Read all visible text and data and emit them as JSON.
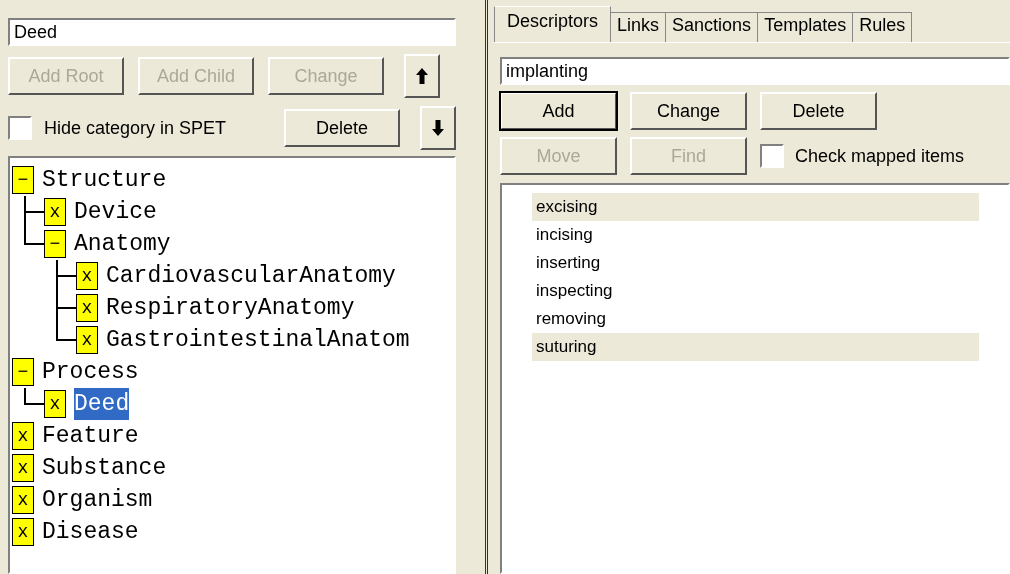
{
  "category_editor": {
    "name_field": {
      "value": "Deed"
    },
    "buttons": [
      {
        "label": "Add Root",
        "disabled": true
      },
      {
        "label": "Add Child",
        "disabled": true
      },
      {
        "label": "Change",
        "disabled": true
      }
    ],
    "move_up_button": {
      "disabled": false
    },
    "hide_checkbox": {
      "label": "Hide category in SPET",
      "checked": false
    },
    "delete_button": {
      "label": "Delete",
      "disabled": false
    },
    "move_down_button": {
      "disabled": false
    },
    "tree": [
      {
        "label": "Structure",
        "toggle": "−",
        "selected": false,
        "children": [
          {
            "label": "Device",
            "toggle": "x",
            "selected": false
          },
          {
            "label": "Anatomy",
            "toggle": "−",
            "selected": false,
            "children": [
              {
                "label": "CardiovascularAnatomy",
                "toggle": "x",
                "selected": false
              },
              {
                "label": "RespiratoryAnatomy",
                "toggle": "x",
                "selected": false
              },
              {
                "label": "GastrointestinalAnatom",
                "toggle": "x",
                "selected": false
              }
            ]
          }
        ]
      },
      {
        "label": "Process",
        "toggle": "−",
        "selected": false,
        "children": [
          {
            "label": "Deed",
            "toggle": "x",
            "selected": true
          }
        ]
      },
      {
        "label": "Feature",
        "toggle": "x",
        "selected": false
      },
      {
        "label": "Substance",
        "toggle": "x",
        "selected": false
      },
      {
        "label": "Organism",
        "toggle": "x",
        "selected": false
      },
      {
        "label": "Disease",
        "toggle": "x",
        "selected": false
      }
    ]
  },
  "tabs": [
    {
      "label": "Descriptors",
      "selected": true
    },
    {
      "label": "Links",
      "selected": false
    },
    {
      "label": "Sanctions",
      "selected": false
    },
    {
      "label": "Templates",
      "selected": false
    },
    {
      "label": "Rules",
      "selected": false
    }
  ],
  "descriptors": {
    "descriptor_field": {
      "value": "implanting"
    },
    "buttons_row_1": [
      {
        "label": "Add",
        "disabled": false,
        "default": true
      },
      {
        "label": "Change",
        "disabled": false,
        "default": false
      },
      {
        "label": "Delete",
        "disabled": false,
        "default": false
      }
    ],
    "buttons_row_2": [
      {
        "label": "Move",
        "disabled": true,
        "default": false
      },
      {
        "label": "Find",
        "disabled": true,
        "default": false
      }
    ],
    "mapped_checkbox": {
      "label": "Check mapped items",
      "checked": false
    },
    "items": [
      {
        "label": "excising",
        "highlighted": true
      },
      {
        "label": "incising",
        "highlighted": false
      },
      {
        "label": "inserting",
        "highlighted": false
      },
      {
        "label": "inspecting",
        "highlighted": false
      },
      {
        "label": "removing",
        "highlighted": false
      },
      {
        "label": "suturing",
        "highlighted": true
      }
    ]
  }
}
